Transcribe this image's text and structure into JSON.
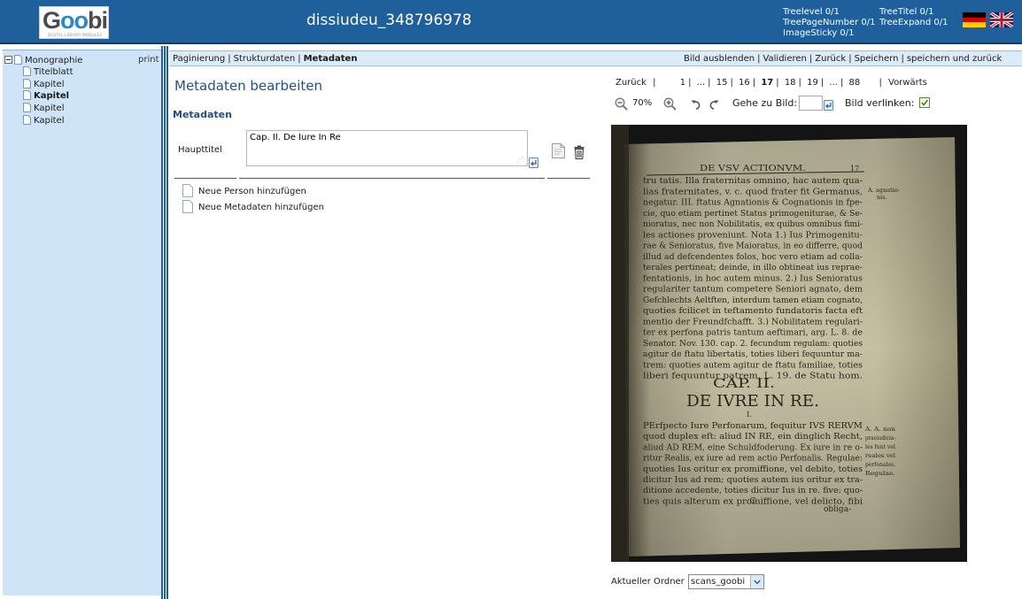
{
  "header": {
    "logo_text": "Goobi",
    "logo_subtitle": "DIGITAL LIBRARY MODULES",
    "doc_title": "dissiudeu_348796978",
    "stats": {
      "treelevel": "Treelevel 0/1",
      "treepagenumber": "TreePageNumber 0/1",
      "imagesticky": "ImageSticky 0/1",
      "treetitel": "TreeTitel 0/1",
      "treeexpand": "TreeExpand 0/1"
    }
  },
  "tree": {
    "print_label": "print",
    "root_label": "Monographie",
    "children": [
      {
        "label": "Titelblatt",
        "bold": false
      },
      {
        "label": "Kapitel",
        "bold": false
      },
      {
        "label": "Kapitel",
        "bold": true
      },
      {
        "label": "Kapitel",
        "bold": false
      },
      {
        "label": "Kapitel",
        "bold": false
      }
    ]
  },
  "navbar": {
    "left": [
      "Paginierung",
      "Strukturdaten",
      "Metadaten"
    ],
    "active": "Metadaten",
    "right": [
      "Bild ausblenden",
      "Validieren",
      "Zurück",
      "Speichern",
      "speichern und zurück"
    ]
  },
  "editor": {
    "heading": "Metadaten bearbeiten",
    "section": "Metadaten",
    "field_label": "Haupttitel",
    "field_value": "Cap. II. De Iure In Re",
    "add_person": "Neue Person hinzufügen",
    "add_metadata": "Neue Metadaten hinzufügen"
  },
  "viewer": {
    "pager": {
      "back": "Zurück",
      "forward": "Vorwärts",
      "pages": [
        "1",
        "...",
        "15",
        "16",
        "17",
        "18",
        "19",
        "...",
        "88"
      ],
      "current": "17"
    },
    "zoom": "70%",
    "goto_label": "Gehe zu Bild:",
    "goto_value": "",
    "link_label": "Bild verlinken:",
    "link_checked": true,
    "folder_label": "Aktueller Ordner",
    "folder_value": "scans_goobi"
  },
  "scan": {
    "running_head": "DE VSV ACTIONVM.",
    "page_number": "17",
    "cap_heading": "CAP. II.",
    "chapter_title": "DE IVRE IN RE.",
    "section_numeral": "I.",
    "catchword": "obliga-",
    "signature": "C",
    "body_lines_top": [
      "tru tatis.  Illa fraternitas omnino, hac autem qua-",
      "lias fraternitates, v. c. quod frater fit Germanus,",
      "negatur.  III. ftatus Agnationis & Cognationis in fpe-",
      "cie, quo etiam pertinet Status primogeniturae, & Se-",
      "nioratus, nec non Nobilitatis, ex quibus omnibus fimi-",
      "les actiones proveniunt.  Nota 1.) Ius Primogenitu-",
      "rae & Senioratus, five Maioratus, in eo differre, quod",
      "illud ad defcendentes folos, hoc vero etiam ad colla-",
      "terales pertineat; deinde, in illo obtineat ius reprae-",
      "fentationis, in hoc autem minus.  2.) Ius Senioratus",
      "regulariter tantum competere Seniori agnato, dem",
      "Gefchlechts Aeltften, interdum tamen etiam cognato,",
      "quoties fcilicet in teftamento fundatoris facta eft",
      "mentio der Freundfchafft.  3.) Nobilitatem regulari-",
      "ter ex perfona patris tantum aeftimari, arg. L. 8. de",
      "Senator. Nov. 130. cap. 2. fecundum regulam: quoties",
      "agitur de ftatu libertatis, toties liberi fequuntur ma-",
      "trem: quoties autem agitur de ftatu familiae, toties",
      "liberi fequuntur patrem, L. 19. de Statu hom."
    ],
    "body_lines_bottom": [
      "PErfpecto Iure Perfonarum, fequitur IVS RERVM",
      "quod duplex eft: aliud IN RE, ein dinglich Recht,",
      "aliud AD REM, eine Schuldfoderung.  Ex iure in re o-",
      "ritur Realis, ex iure ad rem actio Perfonalis.  Regulae:",
      "quoties Ius oritur ex promiffione, vel debito, toties",
      "dicitur Ius ad rem; quoties autem ius oritur ex tra-",
      "ditione accedente, toties dicitur Ius in re.  five: quo-",
      "ties quis alterum ex promiffione, vel delicto, fibi"
    ],
    "margin_notes_top": [
      "A. agnatio-",
      "nis."
    ],
    "margin_notes_bottom": [
      "A. A. non",
      "praeiudicia-",
      "les funt vel",
      "reales vel",
      "perfonales.",
      "Regulae."
    ]
  },
  "colors": {
    "header_bg": "#1f5f9c",
    "tree_bg": "#cfe5f7",
    "navbar_bg": "#dbebf8",
    "heading_blue": "#1f4f8f"
  }
}
